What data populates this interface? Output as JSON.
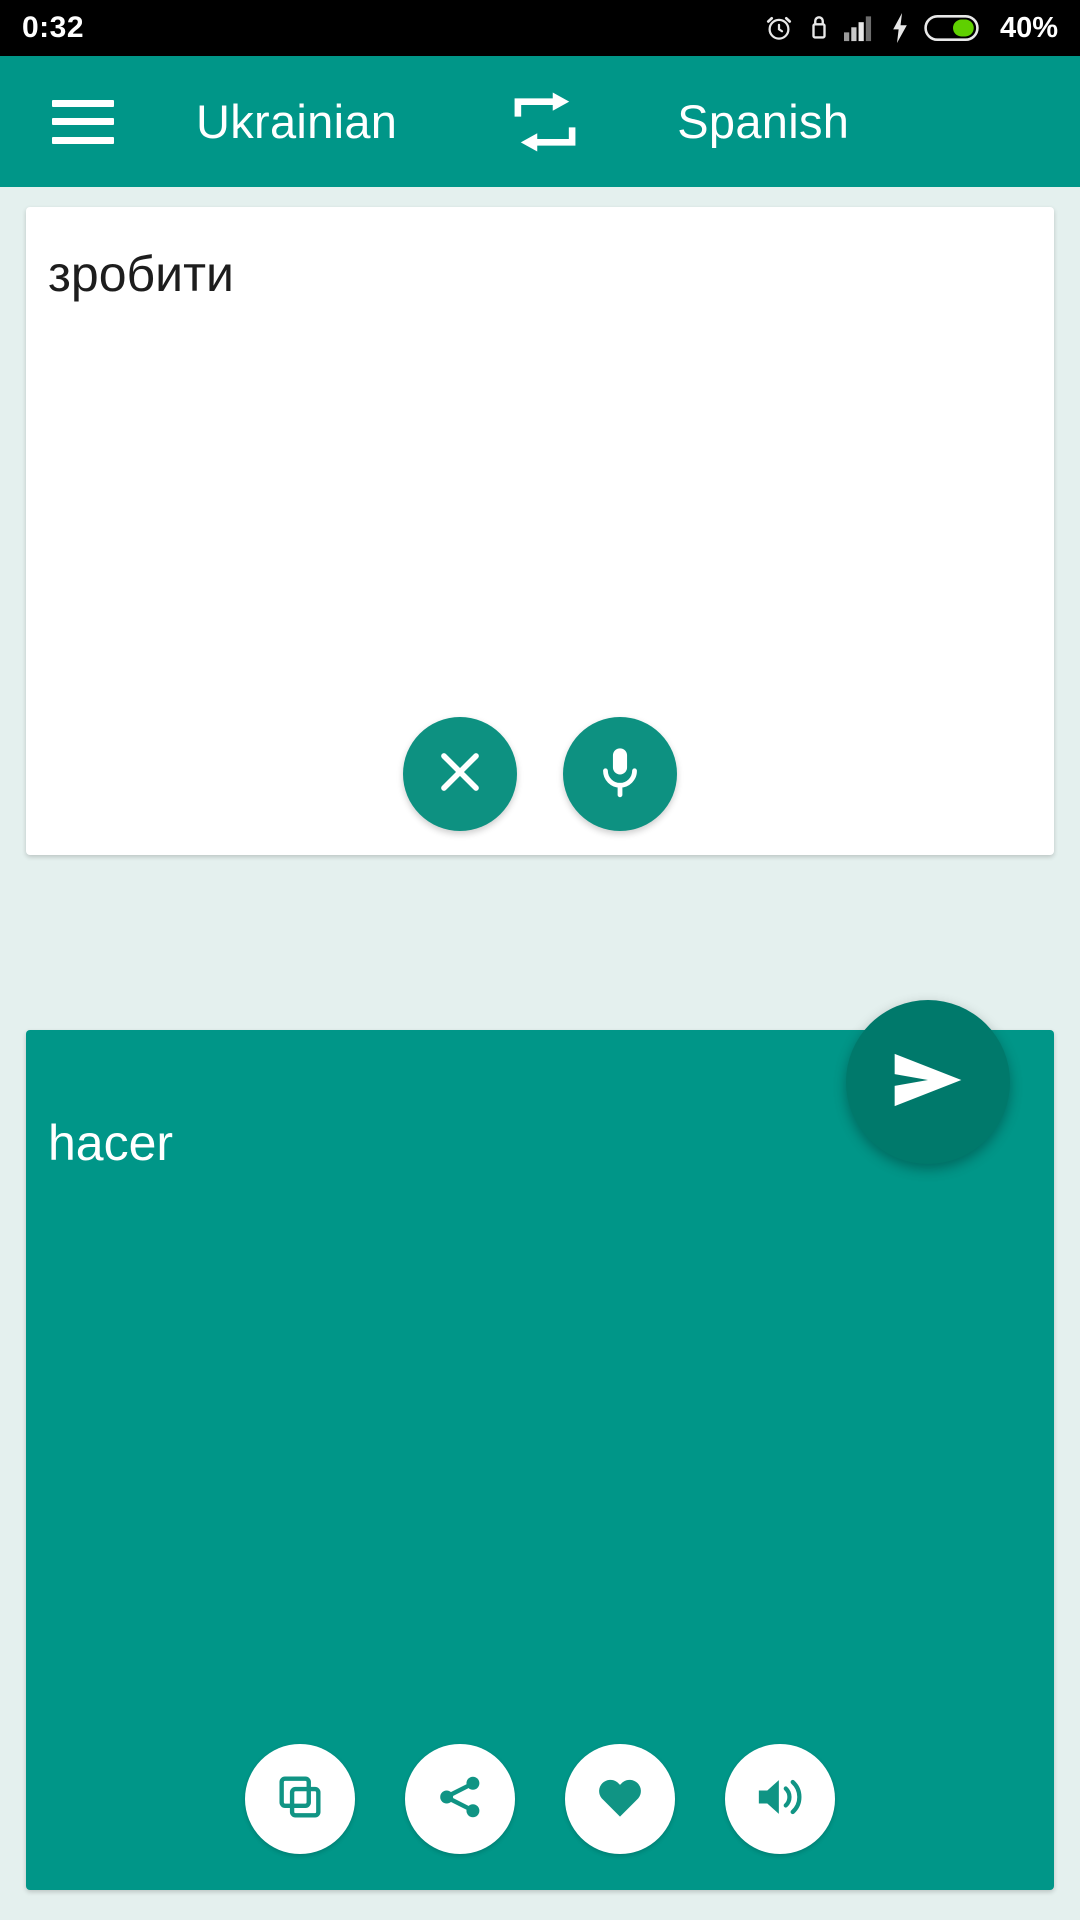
{
  "status_bar": {
    "time": "0:32",
    "battery_percent": "40%",
    "icons": [
      "alarm-clock-icon",
      "lock-icon",
      "signal-bars-icon",
      "charging-bolt-icon",
      "battery-icon"
    ]
  },
  "app_bar": {
    "menu_icon": "hamburger-menu-icon",
    "source_language": "Ukrainian",
    "swap_icon": "swap-languages-icon",
    "target_language": "Spanish"
  },
  "source": {
    "text": "зробити",
    "clear_icon": "close-x-icon",
    "mic_icon": "microphone-icon"
  },
  "send": {
    "icon": "send-arrow-icon"
  },
  "result": {
    "text": "hacer",
    "actions": [
      {
        "icon": "copy-icon"
      },
      {
        "icon": "share-icon"
      },
      {
        "icon": "heart-favorite-icon"
      },
      {
        "icon": "speaker-volume-icon"
      }
    ]
  },
  "colors": {
    "primary": "#009688",
    "primary_dark": "#00796b",
    "accent_circle": "#0d9181",
    "background": "#e4f0ee",
    "status_bar": "#000000",
    "battery_fill": "#5fd000"
  }
}
